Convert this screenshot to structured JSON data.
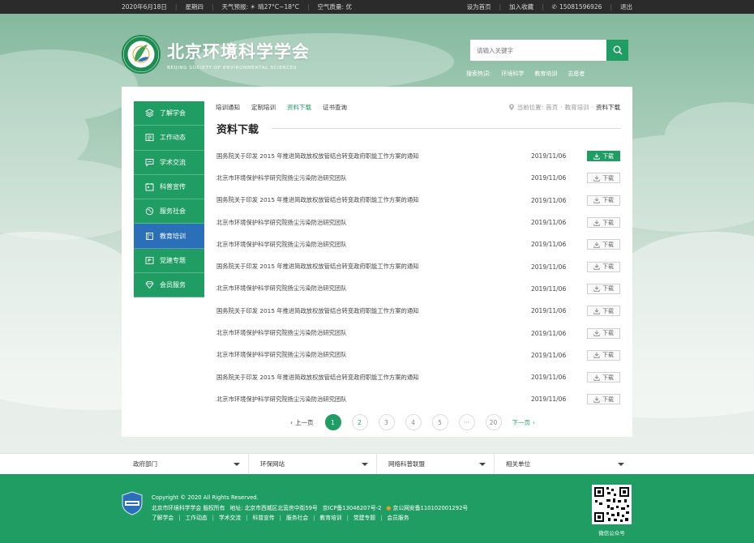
{
  "topbar": {
    "date": "2020年6月18日",
    "weekday": "星期四",
    "weather_label": "天气预报:",
    "weather_value": "晴27°C~18°C",
    "air_label": "空气质量:",
    "air_value": "优",
    "set_home": "设为首页",
    "add_fav": "加入收藏",
    "phone": "15081596926",
    "logout": "退出"
  },
  "header": {
    "site_name": "北京环境科学学会",
    "site_name_en": "BEIJING SOCIETY OF ENVIRONMENTAL SCIENCES",
    "search_placeholder": "请输入关键字",
    "hotwords": [
      "搜索热词:",
      "环境科学",
      "教育培训",
      "志愿者"
    ]
  },
  "sidenav": [
    {
      "label": "了解学会",
      "icon": "layers-icon"
    },
    {
      "label": "工作动态",
      "icon": "news-icon"
    },
    {
      "label": "学术交流",
      "icon": "chat-icon"
    },
    {
      "label": "科普宣传",
      "icon": "calendar-icon"
    },
    {
      "label": "服务社会",
      "icon": "globe-icon"
    },
    {
      "label": "教育培训",
      "icon": "book-icon",
      "active": true
    },
    {
      "label": "党建专题",
      "icon": "flag-icon"
    },
    {
      "label": "会员服务",
      "icon": "diamond-icon"
    }
  ],
  "subtabs": [
    {
      "label": "培训通知"
    },
    {
      "label": "定制培训"
    },
    {
      "label": "资料下载",
      "active": true
    },
    {
      "label": "证书查询"
    }
  ],
  "breadcrumb": {
    "prefix": "当前位置:",
    "home": "首页",
    "sep": "·",
    "parent": "教育培训",
    "current": "资料下载"
  },
  "page_title": "资料下载",
  "download_label": "下载",
  "rows": [
    {
      "title": "国务院关于印发 2015 年推进简政放权放管结合转变政府职能工作方案的通知",
      "date": "2019/11/06",
      "active": true
    },
    {
      "title": "北京市环境保护科学研究院扬尘污染防治研究团队",
      "date": "2019/11/06"
    },
    {
      "title": "国务院关于印发 2015 年推进简政放权放管结合转变政府职能工作方案的通知",
      "date": "2019/11/06"
    },
    {
      "title": "北京市环境保护科学研究院扬尘污染防治研究团队",
      "date": "2019/11/06"
    },
    {
      "title": "北京市环境保护科学研究院扬尘污染防治研究团队",
      "date": "2019/11/06"
    },
    {
      "title": "国务院关于印发 2015 年推进简政放权放管结合转变政府职能工作方案的通知",
      "date": "2019/11/06"
    },
    {
      "title": "北京市环境保护科学研究院扬尘污染防治研究团队",
      "date": "2019/11/06"
    },
    {
      "title": "国务院关于印发 2015 年推进简政放权放管结合转变政府职能工作方案的通知",
      "date": "2019/11/06"
    },
    {
      "title": "北京市环境保护科学研究院扬尘污染防治研究团队",
      "date": "2019/11/06"
    },
    {
      "title": "北京市环境保护科学研究院扬尘污染防治研究团队",
      "date": "2019/11/06"
    },
    {
      "title": "国务院关于印发 2015 年推进简政放权放管结合转变政府职能工作方案的通知",
      "date": "2019/11/06"
    },
    {
      "title": "北京市环境保护科学研究院扬尘污染防治研究团队",
      "date": "2019/11/06"
    }
  ],
  "pager": {
    "prev": "上一页",
    "next": "下一页",
    "pages": [
      "1",
      "2",
      "3",
      "4",
      "5",
      "···",
      "20"
    ],
    "current": "1"
  },
  "links_bar": [
    "政府部门",
    "环保网站",
    "网络科普联盟",
    "相关单位"
  ],
  "footer": {
    "copyright": "Copyright © 2020  All Rights Reserved.",
    "owner": "北京市环境科学学会  版权所有",
    "address": "地址: 北京市西城区北营房中街59号",
    "icp": "京ICP备13046207号-2",
    "police": "京公网安备110102001292号",
    "nav": [
      "了解学会",
      "工作动态",
      "学术交流",
      "科普宣传",
      "服务社会",
      "教育培训",
      "党建专题",
      "会员服务"
    ],
    "qr_label": "微信公众号"
  },
  "colors": {
    "brand_green": "#1f9d63",
    "active_blue": "#2a6fb8",
    "topbar_bg": "#2b2b2b"
  }
}
